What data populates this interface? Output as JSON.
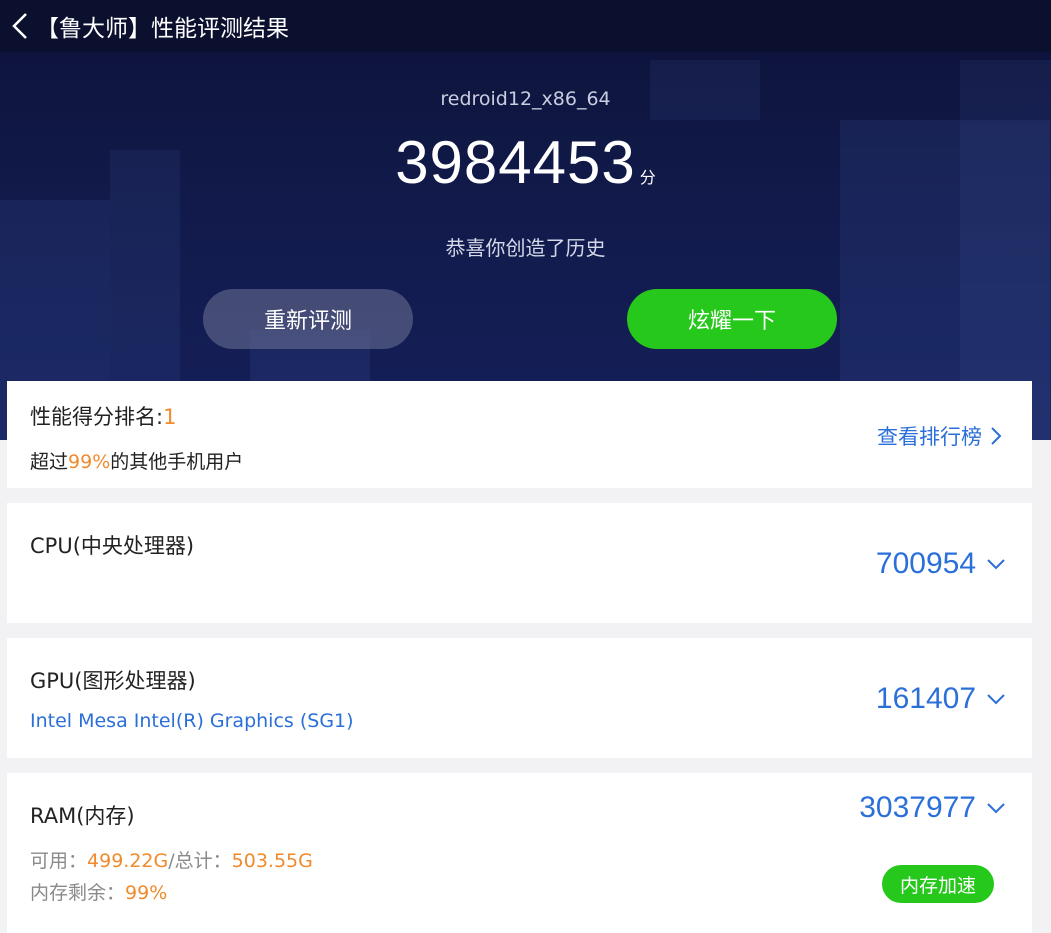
{
  "header": {
    "title": "【鲁大师】性能评测结果"
  },
  "hero": {
    "device": "redroid12_x86_64",
    "score": "3984453",
    "score_unit": "分",
    "congrats": "恭喜你创造了历史",
    "retest_label": "重新评测",
    "share_label": "炫耀一下"
  },
  "rank": {
    "label": "性能得分排名:",
    "value": "1",
    "exceed_prefix": "超过",
    "exceed_pct": "99%",
    "exceed_suffix": "的其他手机用户",
    "link": "查看排行榜"
  },
  "cpu": {
    "label": "CPU(中央处理器)",
    "score": "700954"
  },
  "gpu": {
    "label": "GPU(图形处理器)",
    "model": "Intel Mesa Intel(R) Graphics (SG1)",
    "score": "161407"
  },
  "ram": {
    "label": "RAM(内存)",
    "score": "3037977",
    "avail_label": "可用：",
    "avail_value": "499.22G",
    "total_label": "/总计：",
    "total_value": "503.55G",
    "remain_label": "内存剩余：",
    "remain_value": "99%",
    "accel_label": "内存加速"
  },
  "colors": {
    "hero_bg": "#111a4a",
    "accent_green": "#27c81c",
    "accent_blue": "#2b6fd9",
    "accent_orange": "#f08a2c"
  },
  "icons": [
    "back-arrow-icon",
    "chevron-right-icon",
    "chevron-down-icon"
  ]
}
